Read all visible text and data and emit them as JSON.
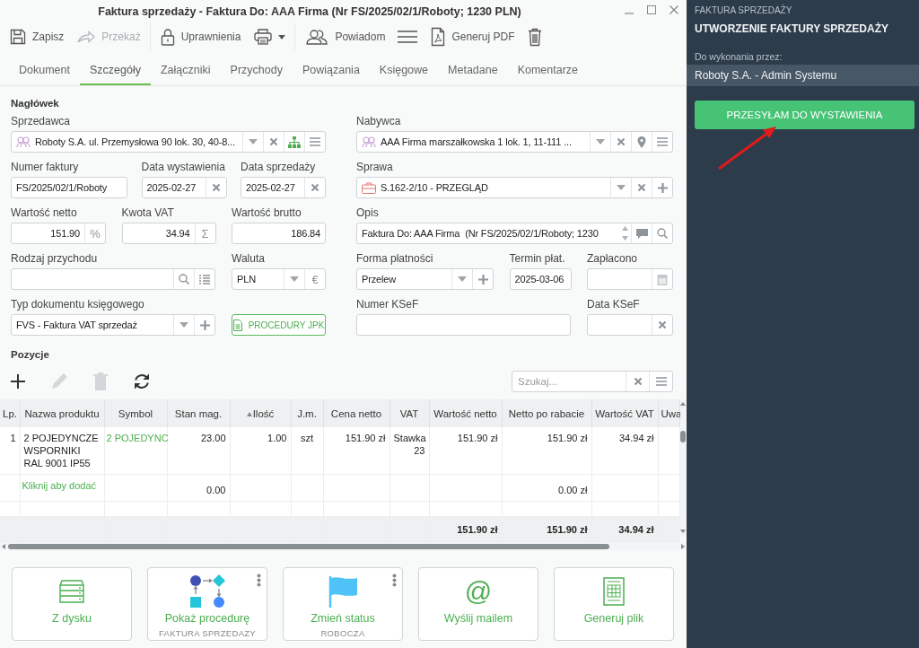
{
  "window": {
    "title": "Faktura sprzedaży - Faktura Do: AAA Firma (Nr FS/2025/02/1/Roboty; 1230 PLN)"
  },
  "toolbar": [
    {
      "kind": "button",
      "label": "Zapisz",
      "disabled": false
    },
    {
      "kind": "button",
      "label": "Przekaż",
      "disabled": true
    },
    {
      "kind": "button",
      "label": "Uprawnienia",
      "disabled": false
    },
    {
      "kind": "dropdown",
      "disabled": false
    },
    {
      "kind": "button",
      "label": "Powiadom",
      "disabled": false
    },
    {
      "kind": "icon",
      "disabled": false
    },
    {
      "kind": "button",
      "label": "Generuj PDF",
      "disabled": false
    },
    {
      "kind": "icon",
      "disabled": false
    }
  ],
  "tabs": [
    {
      "label": "Dokument",
      "selected": false
    },
    {
      "label": "Szczegóły",
      "selected": true
    },
    {
      "label": "Załączniki",
      "selected": false
    },
    {
      "label": "Przychody",
      "selected": false
    },
    {
      "label": "Powiązania",
      "selected": false
    },
    {
      "label": "Księgowe",
      "selected": false
    },
    {
      "label": "Metadane",
      "selected": false
    },
    {
      "label": "Komentarze",
      "selected": false
    }
  ],
  "header": {
    "title": "Nagłówek",
    "left_column": [
      {
        "kind": "field",
        "label": "Sprzedawca",
        "value": "Roboty S.A. ul. Przemysłowa 90 lok. 30, 40-8..."
      },
      {
        "kind": "field",
        "label": "Numer faktury",
        "value": "FS/2025/02/1/Roboty"
      },
      {
        "kind": "field",
        "label": "Data wystawienia",
        "value": "2025-02-27"
      },
      {
        "kind": "field",
        "label": "Data sprzedaży",
        "value": "2025-02-27"
      },
      {
        "kind": "field",
        "label": "Wartość netto",
        "value": "151.90",
        "addon": "%"
      },
      {
        "kind": "field",
        "label": "Kwota VAT",
        "value": "34.94",
        "addon": "Σ"
      },
      {
        "kind": "field",
        "label": "Wartość brutto",
        "value": "186.84"
      },
      {
        "kind": "field",
        "label": "Rodzaj przychodu"
      },
      {
        "kind": "field",
        "label": "Waluta",
        "value": "PLN",
        "addon": "€"
      },
      {
        "kind": "field",
        "label": "Typ dokumentu księgowego",
        "value": "FVS - Faktura VAT sprzedaż"
      },
      {
        "kind": "button",
        "label": "PROCEDURY JPK"
      }
    ],
    "right_column": [
      {
        "kind": "field",
        "label": "Nabywca",
        "value": "AAA Firma marszałkowska 1 lok. 1, 11-111 ..."
      },
      {
        "kind": "field",
        "label": "Sprawa",
        "value": "S.162-2/10 - PRZEGLĄD"
      },
      {
        "kind": "field",
        "label": "Opis",
        "value": "Faktura Do: AAA Firma  (Nr FS/2025/02/1/Roboty; 1230"
      },
      {
        "kind": "field",
        "label": "Forma płatności",
        "value": "Przelew"
      },
      {
        "kind": "field",
        "label": "Termin płat.",
        "value": "2025-03-06"
      },
      {
        "kind": "field",
        "label": "Zapłacono"
      },
      {
        "kind": "field",
        "label": "Numer KSeF"
      },
      {
        "kind": "field",
        "label": "Data KSeF"
      }
    ]
  },
  "positions": {
    "title": "Pozycje",
    "toolbar": [
      {
        "disabled": false
      },
      {
        "disabled": true
      },
      {
        "disabled": true
      },
      {
        "disabled": false
      }
    ],
    "search": {
      "placeholder": "Szukaj..."
    },
    "table": {
      "columns": [
        {
          "label": "Lp.",
          "sorted": false
        },
        {
          "label": "Nazwa produktu",
          "sorted": false
        },
        {
          "label": "Symbol",
          "sorted": false
        },
        {
          "label": "Stan mag.",
          "sorted": false
        },
        {
          "label": "Ilość",
          "sorted": true
        },
        {
          "label": "J.m.",
          "sorted": false
        },
        {
          "label": "Cena netto",
          "sorted": false
        },
        {
          "label": "VAT",
          "sorted": false
        },
        {
          "label": "Wartość netto",
          "sorted": false
        },
        {
          "label": "Netto po rabacie",
          "sorted": false
        },
        {
          "label": "Wartość VAT",
          "sorted": false
        },
        {
          "label": "Uwa",
          "sorted": false
        }
      ],
      "rows": [
        {
          "kind": "item",
          "cells": [
            "1",
            "2 POJEDYNCZE WSPORNIKI RAL 9001 IP55",
            "2 POJEDYNC",
            "23.00",
            "1.00",
            "szt",
            "151.90 zł",
            "Stawka 23",
            "151.90 zł",
            "151.90 zł",
            "34.94 zł",
            null
          ]
        },
        {
          "kind": "add",
          "cells": [
            null,
            "Kliknij aby dodać",
            null,
            "0.00",
            null,
            null,
            null,
            null,
            null,
            "0.00 zł",
            null,
            null
          ]
        },
        {
          "kind": "blank"
        },
        {
          "kind": "total",
          "cells": [
            null,
            null,
            null,
            null,
            null,
            null,
            null,
            null,
            "151.90 zł",
            "151.90 zł",
            "34.94 zł",
            null
          ]
        }
      ]
    }
  },
  "tiles": [
    {
      "label": "Z dysku",
      "menu": false
    },
    {
      "label": "Pokaż procedurę",
      "sub": "FAKTURA SPRZEDAZY",
      "menu": true
    },
    {
      "label": "Zmień status",
      "sub": "ROBOCZA",
      "menu": true
    },
    {
      "label": "Wyślij mailem",
      "symbol": "@",
      "menu": false
    },
    {
      "label": "Generuj plik",
      "menu": false
    }
  ],
  "task_panel": {
    "process": "FAKTURA SPRZEDAŻY",
    "step": "UTWORZENIE FAKTURY SPRZEDAŻY",
    "assignee_label": "Do wykonania przez:",
    "assignee": "Roboty S.A. - Admin Systemu",
    "action": "PRZESYŁAM DO WYSTAWIENIA"
  }
}
